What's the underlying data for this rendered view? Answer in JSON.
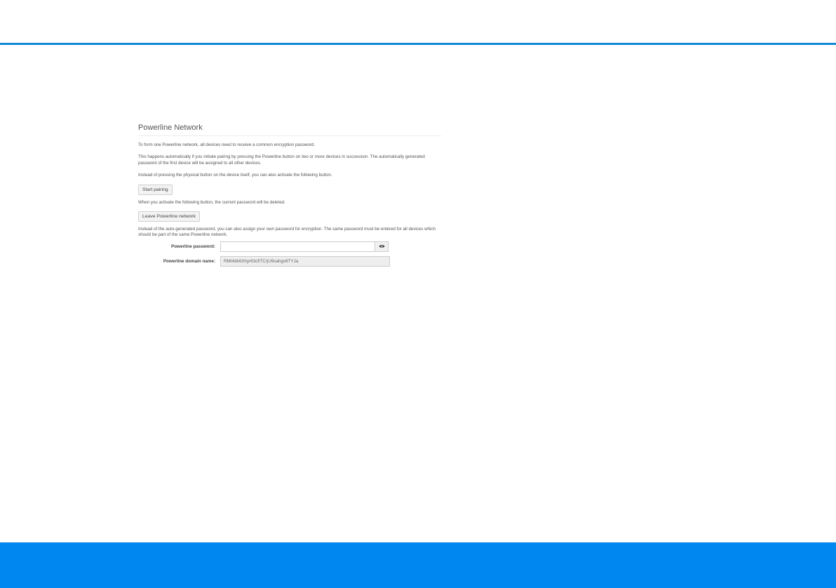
{
  "panel": {
    "title": "Powerline Network",
    "intro": "To form one Powerline network, all devices need to receive a common encryption password.",
    "auto_pairing": "This happens automatically if you initiate pairing by pressing the Powerline button on two or more devices in succession. The automatically generated password of the first device will be assigned to all other devices.",
    "physical_button": "Instead of pressing the physical button on the device itself, you can also activate the following button.",
    "start_pairing_label": "Start pairing",
    "leave_note": "When you activate the following button, the current password will be deleted.",
    "leave_label": "Leave Powerline network",
    "own_password_note": "Instead of the auto-generated password, you can also assign your own password for encryption. The same password must be entered for all devices which should be part of the same Powerline network.",
    "password": {
      "label": "Powerline password:",
      "value": "",
      "visibility_icon": "eye-icon"
    },
    "domain": {
      "label": "Powerline domain name:",
      "value": "RMI4dk6Xhyr63cfiTCrjU9sahgv8TYJa"
    }
  },
  "colors": {
    "accent": "#0e8ad8",
    "footer": "#0088f0"
  }
}
